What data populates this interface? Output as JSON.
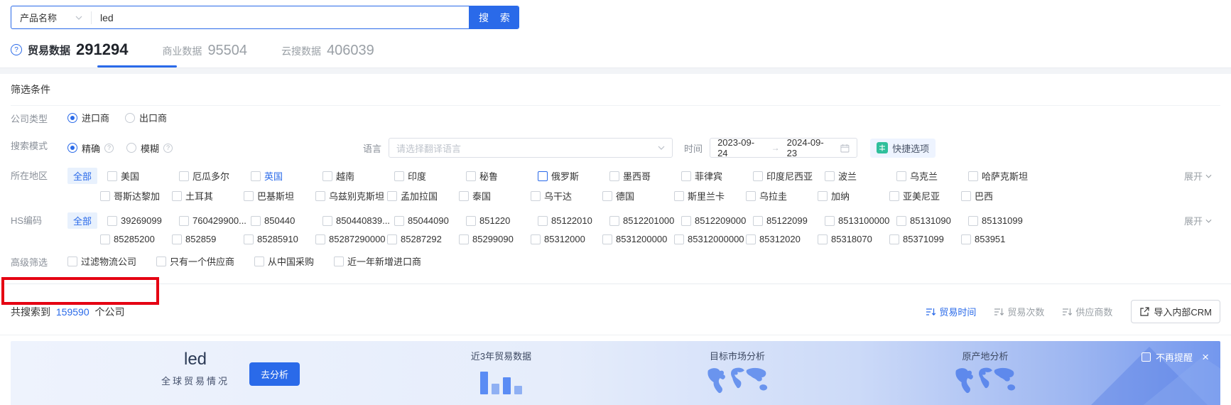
{
  "search": {
    "category": "产品名称",
    "query": "led",
    "button": "搜 索"
  },
  "tabs": [
    {
      "label": "贸易数据",
      "count": "291294",
      "active": true
    },
    {
      "label": "商业数据",
      "count": "95504",
      "active": false
    },
    {
      "label": "云搜数据",
      "count": "406039",
      "active": false
    }
  ],
  "filters": {
    "title": "筛选条件",
    "company_type": {
      "label": "公司类型",
      "options": [
        {
          "label": "进口商",
          "selected": true
        },
        {
          "label": "出口商",
          "selected": false
        }
      ]
    },
    "search_mode": {
      "label": "搜索模式",
      "options": [
        {
          "label": "精确",
          "selected": true
        },
        {
          "label": "模糊",
          "selected": false
        }
      ]
    },
    "language": {
      "label": "语言",
      "placeholder": "请选择翻译语言"
    },
    "time": {
      "label": "时间",
      "start": "2023-09-24",
      "arrow": "→",
      "end": "2024-09-23"
    },
    "quick_option": "快捷选项",
    "region": {
      "label": "所在地区",
      "all": "全部",
      "expand": "展开",
      "row1": [
        "美国",
        "厄瓜多尔",
        {
          "label": "英国",
          "hl": "text"
        },
        "越南",
        "印度",
        "秘鲁",
        {
          "label": "俄罗斯",
          "hl": "box"
        },
        "墨西哥",
        "菲律宾",
        "印度尼西亚",
        "波兰",
        "乌克兰",
        "哈萨克斯坦"
      ],
      "row2": [
        "哥斯达黎加",
        "土耳其",
        "巴基斯坦",
        "乌兹别克斯坦",
        "孟加拉国",
        "泰国",
        "乌干达",
        "德国",
        "斯里兰卡",
        "乌拉圭",
        "加纳",
        "亚美尼亚",
        "巴西"
      ]
    },
    "hs_code": {
      "label": "HS编码",
      "all": "全部",
      "expand": "展开",
      "row1": [
        "39269099",
        "760429900...",
        "850440",
        "850440839...",
        "85044090",
        "851220",
        "85122010",
        "8512201000",
        "8512209000",
        "85122099",
        "8513100000",
        "85131090",
        "85131099"
      ],
      "row2": [
        "85285200",
        "852859",
        "85285910",
        "85287290000",
        "85287292",
        "85299090",
        "85312000",
        "8531200000",
        "85312000000",
        "85312020",
        "85318070",
        "85371099",
        "853951"
      ]
    },
    "advanced": {
      "label": "高级筛选",
      "options": [
        "过滤物流公司",
        "只有一个供应商",
        "从中国采购",
        "近一年新增进口商"
      ]
    }
  },
  "results": {
    "prefix": "共搜索到",
    "count": "159590",
    "suffix": "个公司",
    "sorts": [
      {
        "label": "贸易时间",
        "active": true
      },
      {
        "label": "贸易次数",
        "active": false
      },
      {
        "label": "供应商数",
        "active": false
      }
    ],
    "crm_button": "导入内部CRM"
  },
  "banner": {
    "keyword": "led",
    "subtitle": "全球贸易情况",
    "analyze_button": "去分析",
    "cards": [
      {
        "title": "近3年贸易数据"
      },
      {
        "title": "目标市场分析"
      },
      {
        "title": "原产地分析"
      }
    ],
    "dismiss_label": "不再提醒",
    "close": "×",
    "chart_data": {
      "type": "bar",
      "values": [
        32,
        15,
        24,
        12
      ]
    }
  },
  "colors": {
    "primary": "#2a6ae9",
    "annotation_red": "#e50012",
    "quick_icon_green": "#2fbf9b"
  }
}
